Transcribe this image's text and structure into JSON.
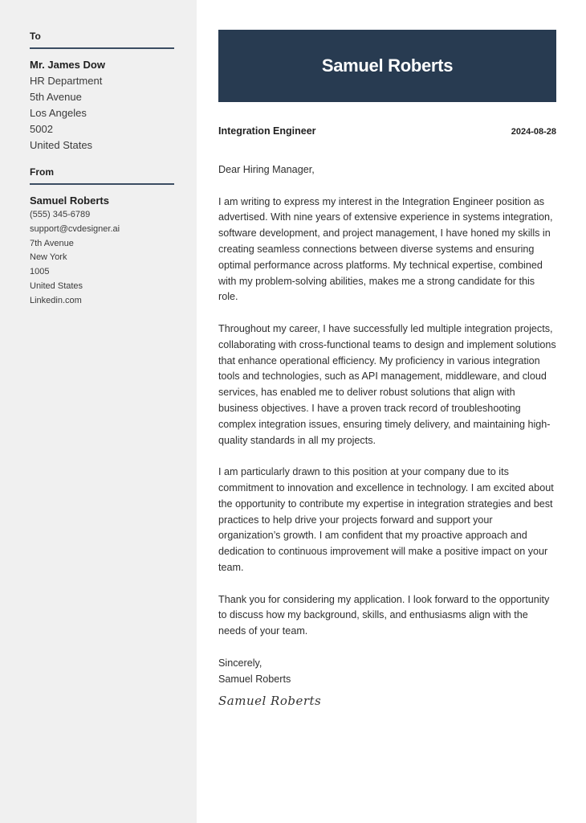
{
  "sidebar": {
    "to": {
      "heading": "To",
      "name": "Mr. James Dow",
      "lines": [
        "HR Department",
        "5th Avenue",
        "Los Angeles",
        "5002",
        "United States"
      ]
    },
    "from": {
      "heading": "From",
      "name": "Samuel Roberts",
      "lines": [
        "(555) 345-6789",
        "support@cvdesigner.ai",
        "7th Avenue",
        "New York",
        "1005",
        "United States",
        "Linkedin.com"
      ]
    }
  },
  "header": {
    "name": "Samuel Roberts",
    "banner_color": "#283b51"
  },
  "meta": {
    "job_title": "Integration Engineer",
    "date": "2024-08-28"
  },
  "letter": {
    "greeting": "Dear Hiring Manager,",
    "paragraphs": [
      "I am writing to express my interest in the Integration Engineer position as advertised. With nine years of extensive experience in systems integration, software development, and project management, I have honed my skills in creating seamless connections between diverse systems and ensuring optimal performance across platforms. My technical expertise, combined with my problem-solving abilities, makes me a strong candidate for this role.",
      "Throughout my career, I have successfully led multiple integration projects, collaborating with cross-functional teams to design and implement solutions that enhance operational efficiency. My proficiency in various integration tools and technologies, such as API management, middleware, and cloud services, has enabled me to deliver robust solutions that align with business objectives. I have a proven track record of troubleshooting complex integration issues, ensuring timely delivery, and maintaining high-quality standards in all my projects.",
      "I am particularly drawn to this position at your company due to its commitment to innovation and excellence in technology. I am excited about the opportunity to contribute my expertise in integration strategies and best practices to help drive your projects forward and support your organization’s growth. I am confident that my proactive approach and dedication to continuous improvement will make a positive impact on your team.",
      "Thank you for considering my application. I look forward to the opportunity to discuss how my background, skills, and enthusiasms align with the needs of your team."
    ],
    "closing": "Sincerely,",
    "sender_name": "Samuel Roberts",
    "signature": "Samuel Roberts"
  }
}
